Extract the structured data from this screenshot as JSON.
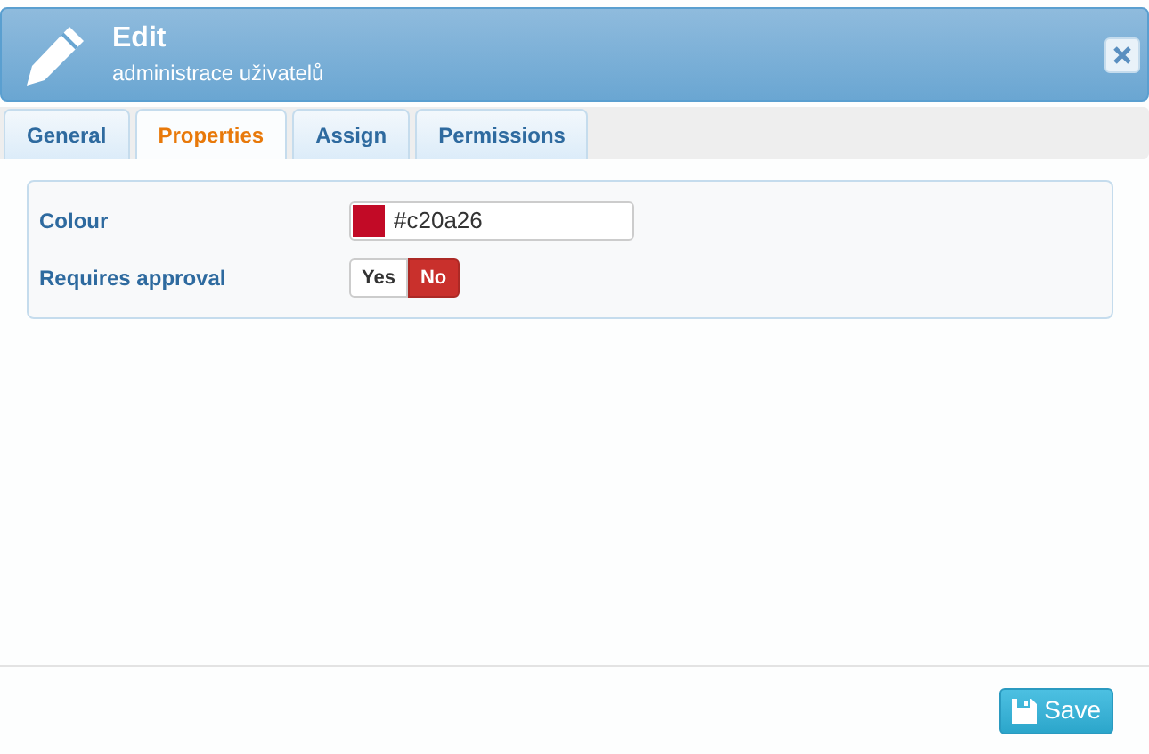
{
  "header": {
    "title": "Edit",
    "subtitle": "administrace uživatelů"
  },
  "tabs": [
    {
      "label": "General",
      "selected": false
    },
    {
      "label": "Properties",
      "selected": true
    },
    {
      "label": "Assign",
      "selected": false
    },
    {
      "label": "Permissions",
      "selected": false
    }
  ],
  "fields": [
    {
      "kind": "color",
      "label": "Colour",
      "value": "#c20a26"
    },
    {
      "kind": "toggle",
      "label": "Requires approval",
      "options": [
        {
          "label": "Yes",
          "selected": false
        },
        {
          "label": "No",
          "selected": true
        }
      ]
    }
  ],
  "footer": {
    "save": "Save"
  }
}
